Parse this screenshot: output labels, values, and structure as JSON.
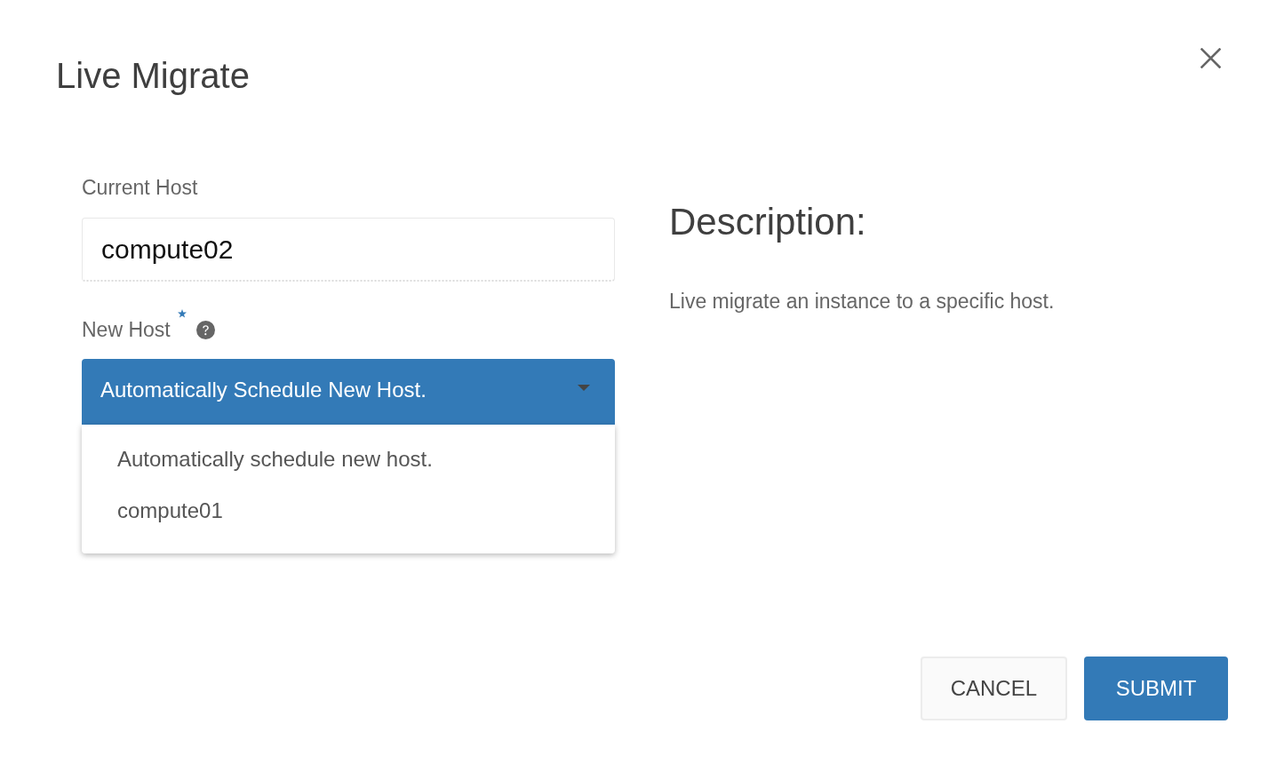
{
  "dialog": {
    "title": "Live Migrate"
  },
  "form": {
    "current_host": {
      "label": "Current Host",
      "value": "compute02"
    },
    "new_host": {
      "label": "New Host",
      "required": true,
      "value": "Automatically Schedule New Host.",
      "expanded": true,
      "options": [
        {
          "label": "Automatically schedule new host.",
          "selected": false
        },
        {
          "label": "compute01",
          "selected": false
        }
      ]
    }
  },
  "description": {
    "heading": "Description:",
    "text": "Live migrate an instance to a specific host."
  },
  "buttons": [
    {
      "label": "CANCEL",
      "kind": "secondary"
    },
    {
      "label": "SUBMIT",
      "kind": "primary"
    }
  ]
}
